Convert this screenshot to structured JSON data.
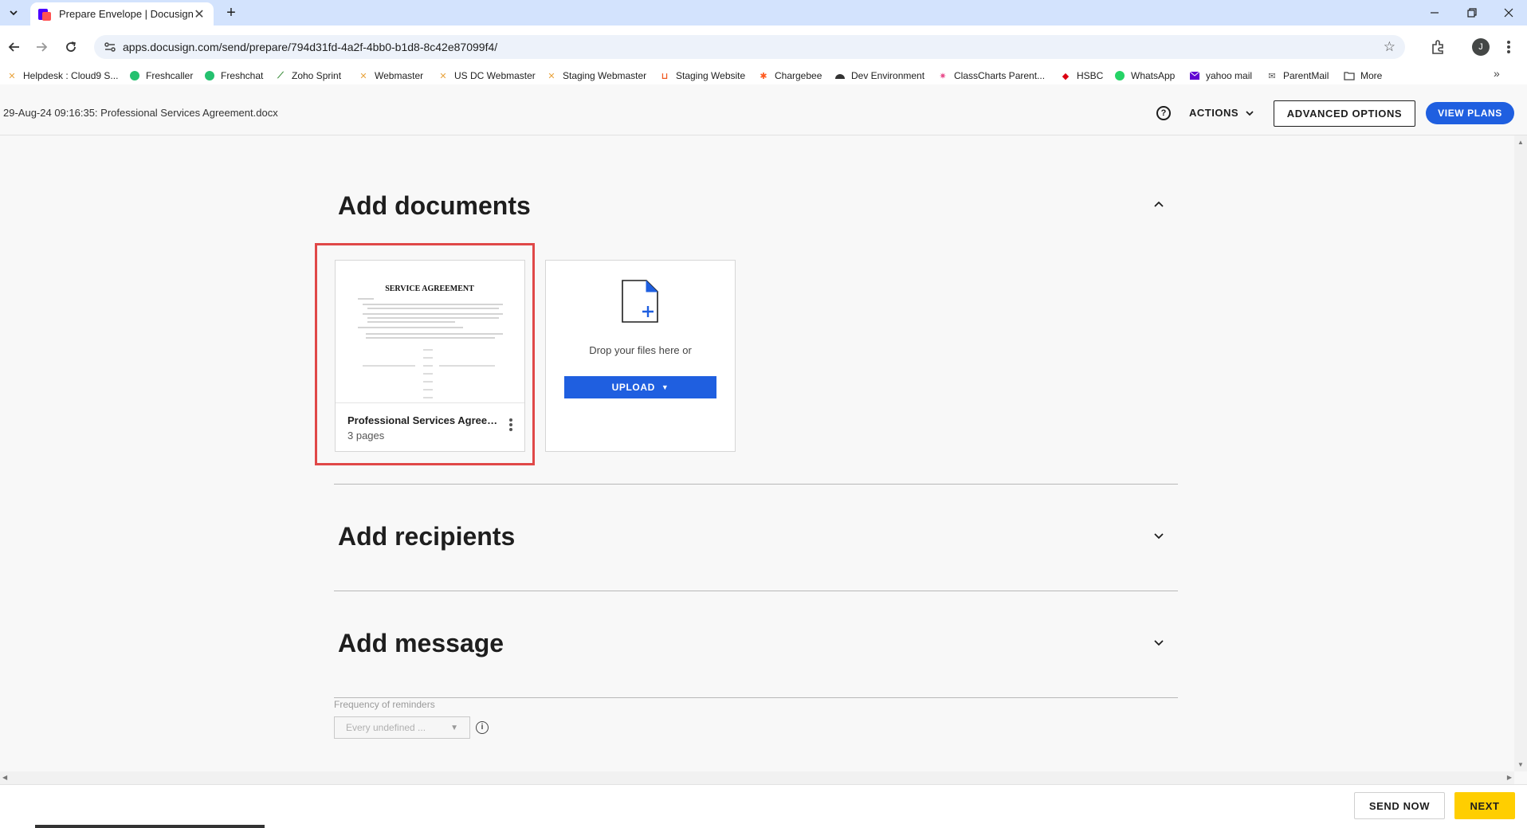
{
  "browser": {
    "tab_title": "Prepare Envelope | Docusign",
    "url": "apps.docusign.com/send/prepare/794d31fd-4a2f-4bb0-b1d8-8c42e87099f4/",
    "avatar_initial": "J",
    "bookmarks": [
      {
        "label": "Helpdesk : Cloud9 S...",
        "icon": "x-icon",
        "color": "#e8a33d"
      },
      {
        "label": "Freshcaller",
        "icon": "phone-icon",
        "color": "#25c16f"
      },
      {
        "label": "Freshchat",
        "icon": "chat-icon",
        "color": "#25c16f"
      },
      {
        "label": "Zoho Sprint",
        "icon": "sprint-icon",
        "color": "#3a8d3a"
      },
      {
        "label": "Webmaster",
        "icon": "x-icon",
        "color": "#e8a33d"
      },
      {
        "label": "US DC Webmaster",
        "icon": "x-icon",
        "color": "#e8a33d"
      },
      {
        "label": "Staging Webmaster",
        "icon": "x-icon",
        "color": "#e8a33d"
      },
      {
        "label": "Staging Website",
        "icon": "bracket-icon",
        "color": "#f05a22"
      },
      {
        "label": "Chargebee",
        "icon": "chargebee-icon",
        "color": "#ff5a1f"
      },
      {
        "label": "Dev Environment",
        "icon": "gauge-icon",
        "color": "#333333"
      },
      {
        "label": "ClassCharts Parent...",
        "icon": "star-icon",
        "color": "#e84a8a"
      },
      {
        "label": "HSBC",
        "icon": "hsbc-icon",
        "color": "#db0011"
      },
      {
        "label": "WhatsApp",
        "icon": "whatsapp-icon",
        "color": "#25d366"
      },
      {
        "label": "yahoo mail",
        "icon": "mail-icon",
        "color": "#6001d2"
      },
      {
        "label": "ParentMail",
        "icon": "parentmail-icon",
        "color": "#555555"
      },
      {
        "label": "More",
        "icon": "folder-icon",
        "color": "#444444"
      }
    ]
  },
  "header": {
    "envelope_title": "29-Aug-24 09:16:35: Professional Services Agreement.docx",
    "actions_label": "ACTIONS",
    "advanced_options_label": "ADVANCED OPTIONS",
    "view_plans_label": "VIEW PLANS"
  },
  "sections": {
    "documents_title": "Add documents",
    "recipients_title": "Add recipients",
    "message_title": "Add message"
  },
  "document": {
    "name": "Professional Services Agreem...",
    "pages": "3 pages",
    "thumbnail_heading": "SERVICE AGREEMENT"
  },
  "dropzone": {
    "text": "Drop your files here or",
    "upload_label": "UPLOAD"
  },
  "reminders": {
    "label": "Frequency of reminders",
    "value": "Every undefined ..."
  },
  "footer": {
    "send_now_label": "SEND NOW",
    "next_label": "NEXT"
  },
  "colors": {
    "primary_blue": "#1f5fe0",
    "next_yellow": "#ffce00",
    "highlight_red": "#e04848"
  }
}
